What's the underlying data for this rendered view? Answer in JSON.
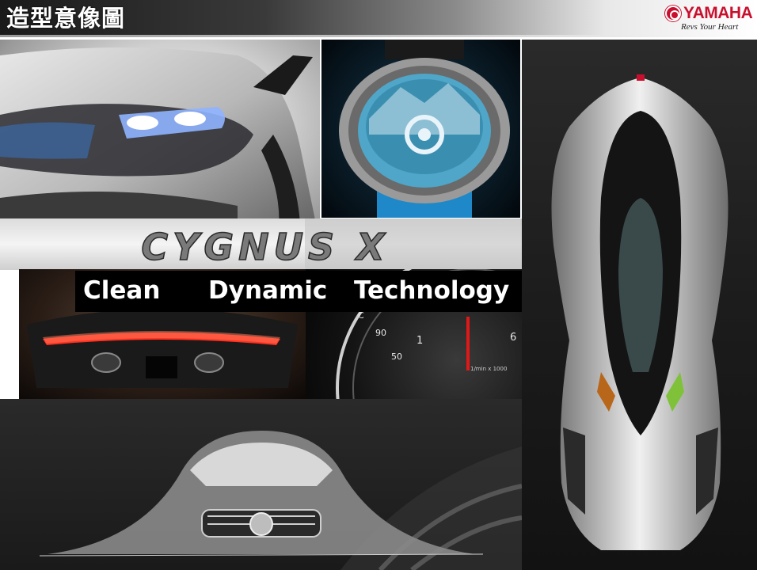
{
  "header": {
    "title": "造型意像圖",
    "logo": {
      "brand": "YAMAHA",
      "tagline": "Revs Your Heart"
    }
  },
  "band": {
    "wordmark": "CYGNUS X"
  },
  "panels": {
    "top_left": {
      "gauge_labels": [
        "C",
        "90",
        "1",
        "50",
        "6",
        "1/min x 1000"
      ]
    }
  },
  "keywords": [
    "Clean",
    "Dynamic",
    "Technology"
  ],
  "colors": {
    "brand_red": "#c8102e",
    "keyword_bg": "#000000",
    "keyword_text": "#ffffff"
  }
}
